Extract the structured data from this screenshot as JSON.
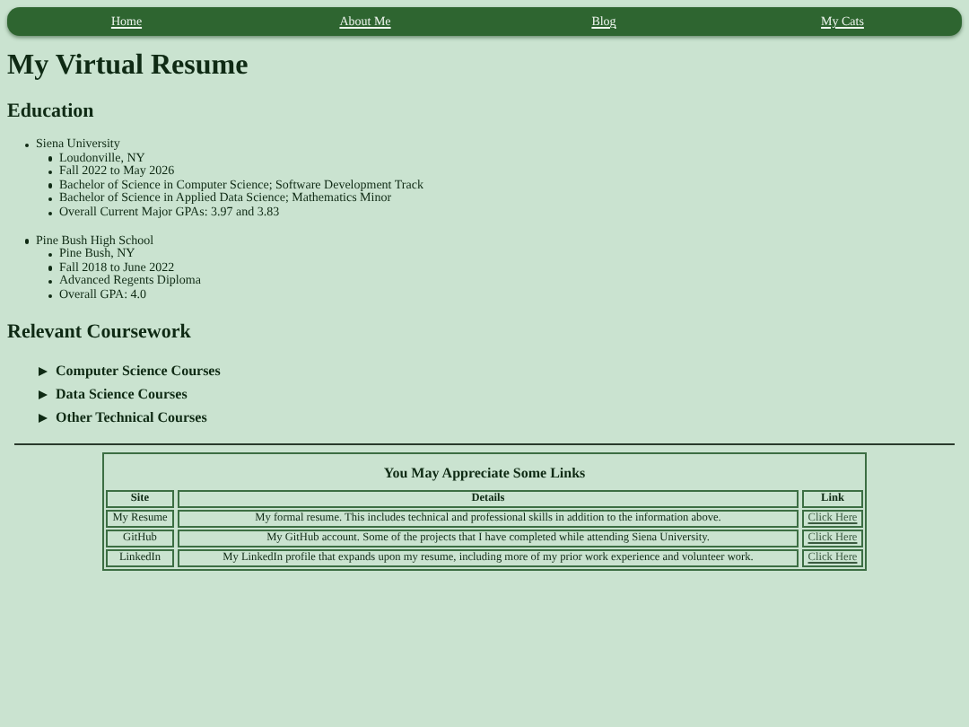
{
  "nav": [
    {
      "label": "Home"
    },
    {
      "label": "About Me"
    },
    {
      "label": "Blog"
    },
    {
      "label": "My Cats"
    }
  ],
  "title": "My Virtual Resume",
  "education": {
    "heading": "Education",
    "schools": [
      {
        "name": "Siena University",
        "details": [
          "Loudonville, NY",
          "Fall 2022 to May 2026",
          "Bachelor of Science in Computer Science; Software Development Track",
          "Bachelor of Science in Applied Data Science; Mathematics Minor",
          "Overall Current Major GPAs: 3.97 and 3.83"
        ]
      },
      {
        "name": "Pine Bush High School",
        "details": [
          "Pine Bush, NY",
          "Fall 2018 to June 2022",
          "Advanced Regents Diploma",
          "Overall GPA: 4.0"
        ]
      }
    ]
  },
  "coursework": {
    "heading": "Relevant Coursework",
    "groups": [
      {
        "label": "Computer Science Courses",
        "expanded": false
      },
      {
        "label": "Data Science Courses",
        "expanded": false
      },
      {
        "label": "Other Technical Courses",
        "expanded": false
      }
    ]
  },
  "links_table": {
    "caption": "You May Appreciate Some Links",
    "columns": [
      "Site",
      "Details",
      "Link"
    ],
    "rows": [
      {
        "site": "My Resume",
        "details": "My formal resume. This includes technical and professional skills in addition to the information above.",
        "link": "Click Here"
      },
      {
        "site": "GitHub",
        "details": "My GitHub account. Some of the projects that I have completed while attending Siena University.",
        "link": "Click Here"
      },
      {
        "site": "LinkedIn",
        "details": "My LinkedIn profile that expands upon my resume, including more of my prior work experience and volunteer work.",
        "link": "Click Here"
      }
    ]
  }
}
